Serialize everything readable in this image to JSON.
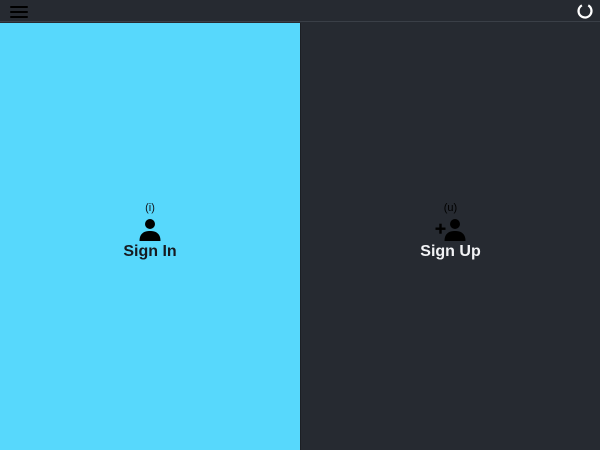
{
  "colors": {
    "topbar_bg": "#262a31",
    "sign_in_panel_bg": "#57d8fc",
    "sign_up_panel_bg": "#262a31",
    "sign_in_text": "#161a20",
    "sign_up_text": "#f2f3f5"
  },
  "topbar": {
    "menu_icon": "hamburger-menu-icon",
    "status_icon": "loading-spinner-icon"
  },
  "panels": {
    "sign_in": {
      "shortcut": "(i)",
      "label": "Sign In",
      "icon": "person-icon"
    },
    "sign_up": {
      "shortcut": "(u)",
      "label": "Sign Up",
      "icon": "person-add-icon"
    }
  }
}
